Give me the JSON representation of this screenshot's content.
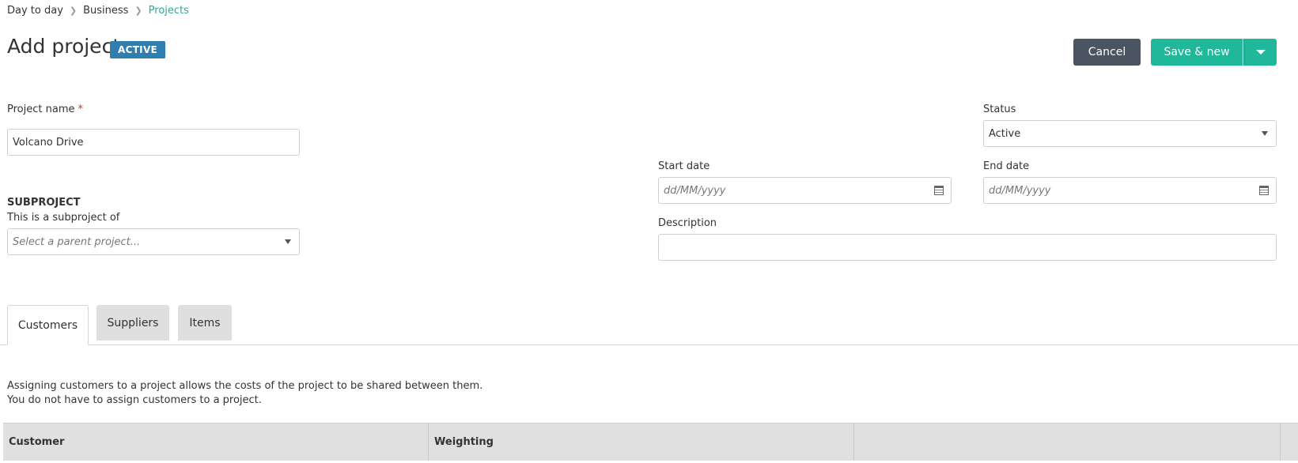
{
  "breadcrumb": {
    "items": [
      "Day to day",
      "Business",
      "Projects"
    ]
  },
  "page": {
    "title": "Add project",
    "badge": "ACTIVE"
  },
  "toolbar": {
    "cancel_label": "Cancel",
    "save_new_label": "Save & new"
  },
  "form": {
    "project_name": {
      "label": "Project name",
      "required_mark": "*",
      "value": "Volcano Drive"
    },
    "subproject": {
      "section_title": "SUBPROJECT",
      "label": "This is a subproject of",
      "placeholder": "Select a parent project..."
    },
    "status": {
      "label": "Status",
      "value": "Active"
    },
    "start_date": {
      "label": "Start date",
      "placeholder": "dd/MM/yyyy"
    },
    "end_date": {
      "label": "End date",
      "placeholder": "dd/MM/yyyy"
    },
    "description": {
      "label": "Description",
      "value": ""
    }
  },
  "tabs": [
    {
      "label": "Customers",
      "active": true
    },
    {
      "label": "Suppliers",
      "active": false
    },
    {
      "label": "Items",
      "active": false
    }
  ],
  "customers_tab": {
    "info_line1": "Assigning customers to a project allows the costs of the project to be shared between them.",
    "info_line2": "You do not have to assign customers to a project.",
    "columns": [
      "Customer",
      "Weighting",
      ""
    ]
  },
  "colors": {
    "accent": "#1fb89a",
    "badge": "#2e7fb0",
    "cancel": "#4a5561",
    "link": "#2fa89a"
  }
}
